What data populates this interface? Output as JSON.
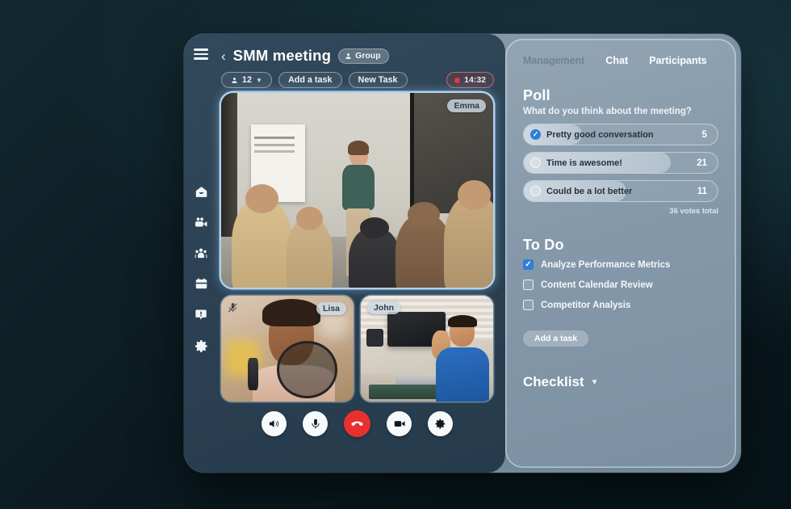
{
  "meeting": {
    "title": "SMM meeting",
    "back_icon": "chevron-left-icon",
    "menu_icon": "hamburger-menu-icon",
    "group_badge": "Group",
    "participants_count": "12",
    "buttons": {
      "add_task": "Add a task",
      "new_task": "New Task"
    },
    "recording_time": "14:32",
    "accent_color": "#2e7fd4",
    "record_color": "#e03b3b",
    "end_call_color": "#e8312e"
  },
  "rail": {
    "items": [
      {
        "icon": "home-icon"
      },
      {
        "icon": "video-camera-icon"
      },
      {
        "icon": "people-group-icon"
      },
      {
        "icon": "calendar-icon"
      },
      {
        "icon": "alert-icon"
      },
      {
        "icon": "settings-gear-icon"
      }
    ]
  },
  "tiles": {
    "main": {
      "name": "Emma",
      "muted": false
    },
    "small": [
      {
        "name": "Lisa",
        "muted": true,
        "mute_icon": "microphone-muted-icon"
      },
      {
        "name": "John",
        "muted": false
      }
    ]
  },
  "controls": [
    {
      "name": "speaker-button",
      "icon": "speaker-icon"
    },
    {
      "name": "microphone-button",
      "icon": "microphone-icon"
    },
    {
      "name": "end-call-button",
      "icon": "phone-hangup-icon"
    },
    {
      "name": "camera-button",
      "icon": "video-camera-icon"
    },
    {
      "name": "settings-button",
      "icon": "settings-gear-icon"
    }
  ],
  "panel": {
    "tabs": [
      {
        "label": "Management",
        "active": false
      },
      {
        "label": "Chat",
        "active": true
      },
      {
        "label": "Participants",
        "active": true
      }
    ],
    "poll": {
      "heading": "Poll",
      "question": "What do you think about the meeting?",
      "options": [
        {
          "label": "Pretty good conversation",
          "votes": "5",
          "percent": 30,
          "selected": true
        },
        {
          "label": "Time is awesome!",
          "votes": "21",
          "percent": 76,
          "selected": false
        },
        {
          "label": "Could be a lot better",
          "votes": "11",
          "percent": 53,
          "selected": false
        }
      ],
      "total": "36 votes total"
    },
    "todo": {
      "heading": "To Do",
      "items": [
        {
          "label": "Analyze Performance Metrics",
          "done": true
        },
        {
          "label": "Content Calendar Review",
          "done": false
        },
        {
          "label": "Competitor Analysis",
          "done": false
        }
      ],
      "add_button": "Add a task"
    },
    "checklist": {
      "heading": "Checklist",
      "chevron": "chevron-down-icon"
    }
  }
}
